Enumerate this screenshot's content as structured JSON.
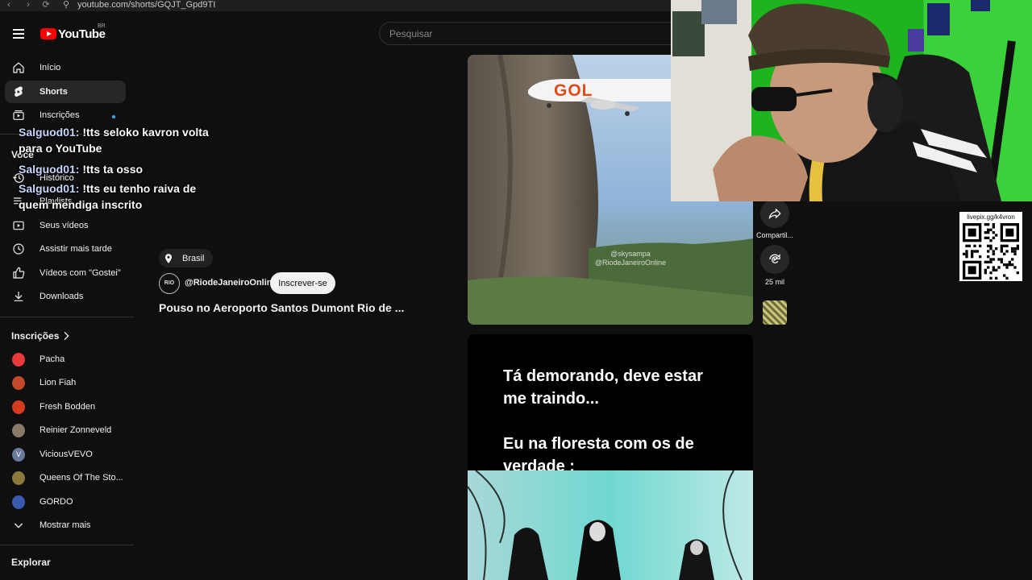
{
  "browser": {
    "url": "youtube.com/shorts/GQJT_Gpd9TI"
  },
  "header": {
    "logo_text": "YouTube",
    "region": "BR",
    "search_placeholder": "Pesquisar"
  },
  "sidebar": {
    "main": [
      {
        "label": "Início",
        "icon": "home-icon"
      },
      {
        "label": "Shorts",
        "icon": "shorts-icon",
        "active": true
      },
      {
        "label": "Inscrições",
        "icon": "subscriptions-icon"
      }
    ],
    "voce_title": "Você",
    "voce_items": [
      {
        "label": "Histórico",
        "icon": "history-icon"
      },
      {
        "label": "Playlists",
        "icon": "playlist-icon"
      },
      {
        "label": "Seus vídeos",
        "icon": "your-videos-icon"
      },
      {
        "label": "Assistir mais tarde",
        "icon": "clock-icon"
      },
      {
        "label": "Vídeos com \"Gostei\"",
        "icon": "thumbs-up-icon"
      },
      {
        "label": "Downloads",
        "icon": "download-icon"
      }
    ],
    "subs_title": "Inscrições",
    "subs": [
      {
        "label": "Pacha",
        "color": "#e83a3a"
      },
      {
        "label": "Lion Fiah",
        "color": "#c24a2a"
      },
      {
        "label": "Fresh Bodden",
        "color": "#d63b1f"
      },
      {
        "label": "Reinier Zonneveld",
        "color": "#8a7a6a"
      },
      {
        "label": "ViciousVEVO",
        "color": "#6a7a9a",
        "initial": "V"
      },
      {
        "label": "Queens Of The Sto...",
        "color": "#8a7a3a"
      },
      {
        "label": "GORDO",
        "color": "#3a5ab0"
      }
    ],
    "show_more": "Mostrar mais",
    "explore_title": "Explorar"
  },
  "chat": [
    {
      "user": "Salguod01:",
      "text": " !tts seloko kavron volta para o YouTube"
    },
    {
      "user": "Salguod01:",
      "text": " !tts ta osso"
    },
    {
      "user": "Salguod01:",
      "text": " !tts eu tenho raiva de quem mendiga inscrito"
    }
  ],
  "video": {
    "location": "Brasil",
    "channel_avatar_text": "RIO",
    "channel": "@RiodeJaneiroOnline",
    "subscribe_label": "Inscrever-se",
    "title": "Pouso no Aeroporto Santos Dumont Rio de ...",
    "plane_text": "GOL",
    "watermark_1": "@skysampa",
    "watermark_2": "@RiodeJaneiroOnline"
  },
  "actions": {
    "share_label": "Compartil...",
    "remix_label": "25 mil"
  },
  "next_short": {
    "caption": "Tá demorando, deve estar\nme traindo...\n\nEu na floresta com os de\nverdade :"
  },
  "overlay": {
    "qr_label": "livepix.gg/k4vron"
  }
}
